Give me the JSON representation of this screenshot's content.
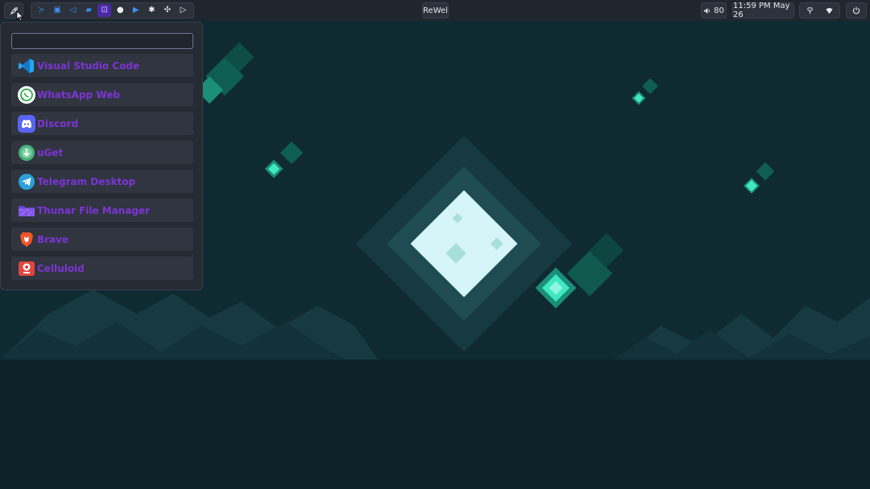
{
  "topbar": {
    "launcher_icon": "rocket-icon",
    "dock": [
      {
        "name": "terminal",
        "icon": "terminal-icon",
        "color": "#3d8ef0",
        "glyph": "≻"
      },
      {
        "name": "browser",
        "icon": "window-icon",
        "color": "#3d8ef0",
        "glyph": "▣"
      },
      {
        "name": "vscode",
        "icon": "vscode-icon",
        "color": "#3d8ef0",
        "glyph": "◁"
      },
      {
        "name": "files",
        "icon": "folder-icon",
        "color": "#3d8ef0",
        "glyph": "▰"
      },
      {
        "name": "app-active",
        "icon": "app-grid-icon",
        "color": "#d0c6ff",
        "glyph": "⊡",
        "active": true
      },
      {
        "name": "chat",
        "icon": "chat-bubble-icon",
        "color": "#f0f0f0",
        "glyph": "●"
      },
      {
        "name": "media",
        "icon": "media-icon",
        "color": "#3d8ef0",
        "glyph": "▶"
      },
      {
        "name": "settings",
        "icon": "gear-icon",
        "color": "#f0f0f0",
        "glyph": "✱"
      },
      {
        "name": "games",
        "icon": "gamepad-icon",
        "color": "#f0f0f0",
        "glyph": "✣"
      },
      {
        "name": "send",
        "icon": "send-icon",
        "color": "#f0f0f0",
        "glyph": "▷"
      }
    ],
    "window_title": "ReWel",
    "volume_icon": "speaker-icon",
    "volume_value": "80",
    "clock": "11:59 PM May 26",
    "tray": [
      "network-icon",
      "wifi-icon"
    ],
    "power_icon": "power-icon"
  },
  "launcher": {
    "search": {
      "value": "",
      "placeholder": ""
    },
    "apps": [
      {
        "label": "Visual Studio Code",
        "icon": "vscode-icon"
      },
      {
        "label": "WhatsApp Web",
        "icon": "whatsapp-icon"
      },
      {
        "label": "Discord",
        "icon": "discord-icon"
      },
      {
        "label": "uGet",
        "icon": "uget-icon"
      },
      {
        "label": "Telegram Desktop",
        "icon": "telegram-icon"
      },
      {
        "label": "Thunar File Manager",
        "icon": "folder-icon"
      },
      {
        "label": "Brave",
        "icon": "brave-icon"
      },
      {
        "label": "Celluloid",
        "icon": "celluloid-icon"
      }
    ]
  },
  "colors": {
    "bar_bg": "#21262e",
    "menu_bg": "#262a33",
    "item_bg": "#30353f",
    "label": "#7b35d4",
    "accent_teal": "#2ee6c0",
    "sky": "#0d2a31"
  }
}
